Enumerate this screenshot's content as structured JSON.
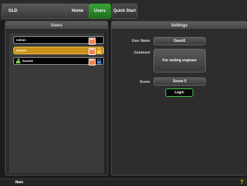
{
  "top": {
    "device_tab": "GLD",
    "home_tab": "Home",
    "users_tab": "Users",
    "quick_start_tab": "Quick Start"
  },
  "users_panel": {
    "title": "Users",
    "items": [
      {
        "label": "Admin",
        "selected": false
      },
      {
        "label": "Guest1",
        "selected": true
      },
      {
        "label": "Guest2",
        "selected": false
      }
    ]
  },
  "settings_panel": {
    "title": "Settings",
    "user_name_label": "User Name",
    "user_name_value": "Guest1",
    "comment_label": "Comment",
    "comment_value": "For visiting engineer",
    "scene_label": "Scene",
    "scene_value": "Scene 5",
    "login_label": "Login"
  },
  "bottom": {
    "main_label": "Main",
    "help_icon": "?"
  },
  "colors": {
    "accent_green": "#3aa43a",
    "selected_orange": "#c9901a",
    "help_yellow": "#f2c000"
  }
}
